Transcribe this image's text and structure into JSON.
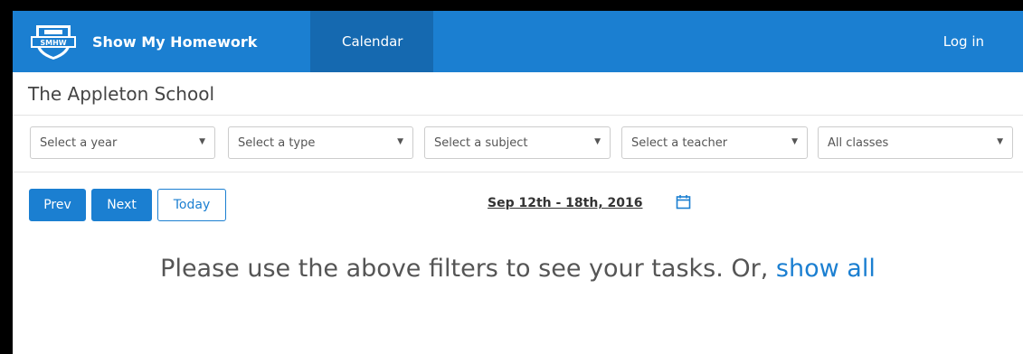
{
  "header": {
    "logo_text": "SMHW",
    "brand": "Show My Homework",
    "nav_calendar": "Calendar",
    "login": "Log in"
  },
  "school": {
    "name": "The Appleton School"
  },
  "filters": {
    "year": "Select a year",
    "type": "Select a type",
    "subject": "Select a subject",
    "teacher": "Select a teacher",
    "classes": "All classes"
  },
  "toolbar": {
    "prev": "Prev",
    "next": "Next",
    "today": "Today",
    "date_range": "Sep 12th - 18th, 2016"
  },
  "message": {
    "text": "Please use the above filters to see your tasks. Or, ",
    "link": "show all"
  },
  "colors": {
    "brand_blue": "#1b7fd1",
    "active_nav": "#1569b0"
  }
}
